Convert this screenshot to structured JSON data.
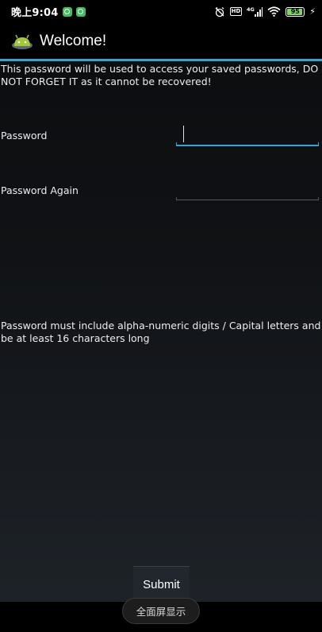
{
  "status_bar": {
    "time": "晚上9:04",
    "network": "4G",
    "hd": "HD",
    "battery": "95",
    "charging_icon": "bolt-icon"
  },
  "action_bar": {
    "title": "Welcome!",
    "app_icon": "android-icon"
  },
  "form": {
    "intro": "This password will be used to access your saved passwords, DO NOT FORGET IT as it cannot be recovered!",
    "password_label": "Password",
    "password_value": "",
    "password_again_label": "Password Again",
    "password_again_value": "",
    "rules": "Password must include alpha-numeric digits / Capital letters and be at least 16 characters long",
    "submit_label": "Submit"
  },
  "nav": {
    "fullscreen_label": "全面屏显示"
  },
  "colors": {
    "accent": "#33a4d9",
    "battery": "#7ed957"
  }
}
